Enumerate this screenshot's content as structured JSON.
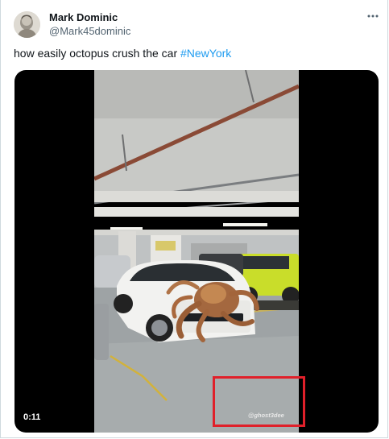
{
  "tweet": {
    "author": {
      "name": "Mark Dominic",
      "handle": "@Mark45dominic"
    },
    "text": "how easily octopus crush the car ",
    "hashtag": "#NewYork",
    "more_icon": "more-horizontal-icon"
  },
  "media": {
    "duration": "0:11",
    "watermark": "@ghost3dee",
    "highlight_color": "#e0202a"
  },
  "colors": {
    "text": "#0f1419",
    "secondary": "#536471",
    "link": "#1d9bf0",
    "border": "#cfd9de"
  }
}
